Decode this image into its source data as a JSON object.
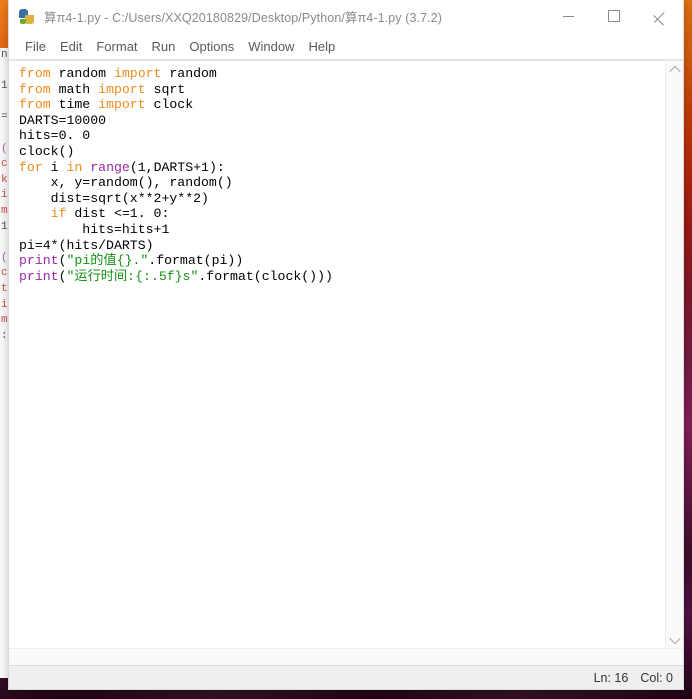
{
  "window": {
    "title": "算π4-1.py - C:/Users/XXQ20180829/Desktop/Python/算π4-1.py (3.7.2)",
    "icon": "python-idle-icon",
    "controls": {
      "minimize": "Minimize",
      "maximize": "Maximize",
      "close": "Close"
    }
  },
  "menu": {
    "items": [
      {
        "label": "File"
      },
      {
        "label": "Edit"
      },
      {
        "label": "Format"
      },
      {
        "label": "Run"
      },
      {
        "label": "Options"
      },
      {
        "label": "Window"
      },
      {
        "label": "Help"
      }
    ]
  },
  "editor": {
    "lines": [
      {
        "tokens": [
          {
            "t": "from",
            "c": "kw"
          },
          {
            "t": " random ",
            "c": "pln"
          },
          {
            "t": "import",
            "c": "kw"
          },
          {
            "t": " random",
            "c": "pln"
          }
        ]
      },
      {
        "tokens": [
          {
            "t": "from",
            "c": "kw"
          },
          {
            "t": " math ",
            "c": "pln"
          },
          {
            "t": "import",
            "c": "kw"
          },
          {
            "t": " sqrt",
            "c": "pln"
          }
        ]
      },
      {
        "tokens": [
          {
            "t": "from",
            "c": "kw"
          },
          {
            "t": " time ",
            "c": "pln"
          },
          {
            "t": "import",
            "c": "kw"
          },
          {
            "t": " clock",
            "c": "pln"
          }
        ]
      },
      {
        "tokens": [
          {
            "t": "DARTS=10000",
            "c": "pln"
          }
        ]
      },
      {
        "tokens": [
          {
            "t": "hits=0. 0",
            "c": "pln"
          }
        ]
      },
      {
        "tokens": [
          {
            "t": "clock()",
            "c": "pln"
          }
        ]
      },
      {
        "tokens": [
          {
            "t": "for",
            "c": "kw"
          },
          {
            "t": " i ",
            "c": "pln"
          },
          {
            "t": "in",
            "c": "kw"
          },
          {
            "t": " ",
            "c": "pln"
          },
          {
            "t": "range",
            "c": "bi"
          },
          {
            "t": "(1,DARTS+1):",
            "c": "pln"
          }
        ]
      },
      {
        "tokens": [
          {
            "t": "    x, y=random(), random()",
            "c": "pln"
          }
        ]
      },
      {
        "tokens": [
          {
            "t": "    dist=sqrt(x**2+y**2)",
            "c": "pln"
          }
        ]
      },
      {
        "tokens": [
          {
            "t": "    ",
            "c": "pln"
          },
          {
            "t": "if",
            "c": "kw"
          },
          {
            "t": " dist <=1. 0:",
            "c": "pln"
          }
        ]
      },
      {
        "tokens": [
          {
            "t": "        hits=hits+1",
            "c": "pln"
          }
        ]
      },
      {
        "tokens": [
          {
            "t": "pi=4*(hits/DARTS)",
            "c": "pln"
          }
        ]
      },
      {
        "tokens": [
          {
            "t": "print",
            "c": "bi"
          },
          {
            "t": "(",
            "c": "pln"
          },
          {
            "t": "\"pi的值{}.\"",
            "c": "str"
          },
          {
            "t": ".format(pi))",
            "c": "pln"
          }
        ]
      },
      {
        "tokens": [
          {
            "t": "print",
            "c": "bi"
          },
          {
            "t": "(",
            "c": "pln"
          },
          {
            "t": "\"运行时间:{:.5f}s\"",
            "c": "str"
          },
          {
            "t": ".format(clock()))",
            "c": "pln"
          }
        ]
      }
    ]
  },
  "scrollbars": {
    "vertical_up": "scroll-up",
    "vertical_down": "scroll-down"
  },
  "status": {
    "line": "Ln: 16",
    "column": "Col: 0"
  },
  "background_window": {
    "lines": [
      {
        "t": "n",
        "c": "bg-bk"
      },
      {
        "t": "",
        "c": "bg-bk"
      },
      {
        "t": "1",
        "c": "bg-bk"
      },
      {
        "t": "",
        "c": "bg-bk"
      },
      {
        "t": "=",
        "c": "bg-bk"
      },
      {
        "t": "",
        "c": "bg-bk"
      },
      {
        "t": "(",
        "c": "bg-pu"
      },
      {
        "t": "c",
        "c": "bg-re"
      },
      {
        "t": "k",
        "c": "bg-re"
      },
      {
        "t": "i",
        "c": "bg-re"
      },
      {
        "t": "m",
        "c": "bg-re"
      },
      {
        "t": "1",
        "c": "bg-bk"
      },
      {
        "t": "",
        "c": "bg-bk"
      },
      {
        "t": "(",
        "c": "bg-pu"
      },
      {
        "t": "c",
        "c": "bg-re"
      },
      {
        "t": "t",
        "c": "bg-re"
      },
      {
        "t": "i",
        "c": "bg-re"
      },
      {
        "t": "m",
        "c": "bg-re"
      },
      {
        "t": ":",
        "c": "bg-bk"
      }
    ]
  },
  "colors": {
    "keyword": "#ef8a1a",
    "builtin": "#9a26a6",
    "string": "#169116",
    "text": "#000000",
    "window_bg": "#ffffff",
    "status_bg": "#efefef"
  }
}
